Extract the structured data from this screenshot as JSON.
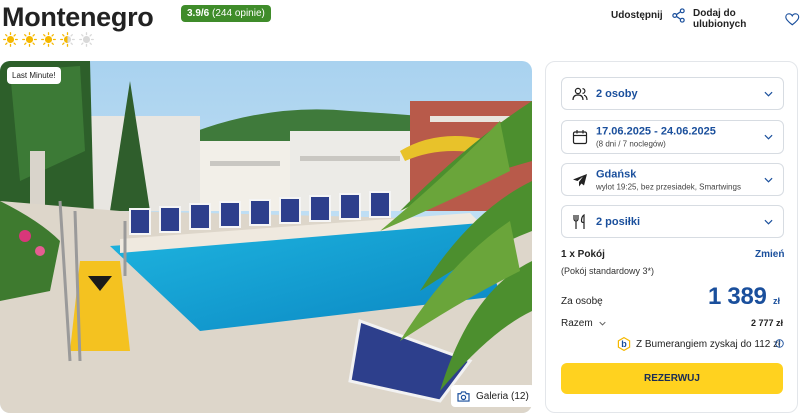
{
  "header": {
    "title": "Montenegro",
    "rating_score": "3.9/6",
    "rating_count": "(244 opinie)",
    "sun_rating": 3.5,
    "share_label": "Udostępnij",
    "favorite_label": "Dodaj do ulubionych"
  },
  "photo": {
    "badge": "Last Minute!",
    "gallery_label": "Galeria (12)"
  },
  "booking": {
    "people": {
      "label": "2 osoby",
      "icon": "people-icon"
    },
    "dates": {
      "label": "17.06.2025 - 24.06.2025",
      "sub": "(8 dni / 7 noclegów)",
      "icon": "calendar-icon"
    },
    "departure": {
      "label": "Gdańsk",
      "sub": "wylot 19:25, bez przesiadek, Smartwings",
      "icon": "plane-icon"
    },
    "meals": {
      "label": "2 posiłki",
      "icon": "cutlery-icon"
    },
    "room_count": "1 x Pokój",
    "change_label": "Zmień",
    "room_type": "(Pokój standardowy 3*)",
    "per_person_label": "Za osobę",
    "price": "1 389",
    "currency": "zł",
    "total_label": "Razem",
    "total_value": "2 777 zł",
    "bumerang_text": "Z Bumerangiem zyskaj do 112 zł",
    "reserve_label": "REZERWUJ"
  },
  "colors": {
    "accent_blue": "#1a4f9c",
    "rating_green": "#3f8c2a",
    "reserve_yellow": "#ffd21f",
    "sun_yellow": "#f5b800"
  }
}
